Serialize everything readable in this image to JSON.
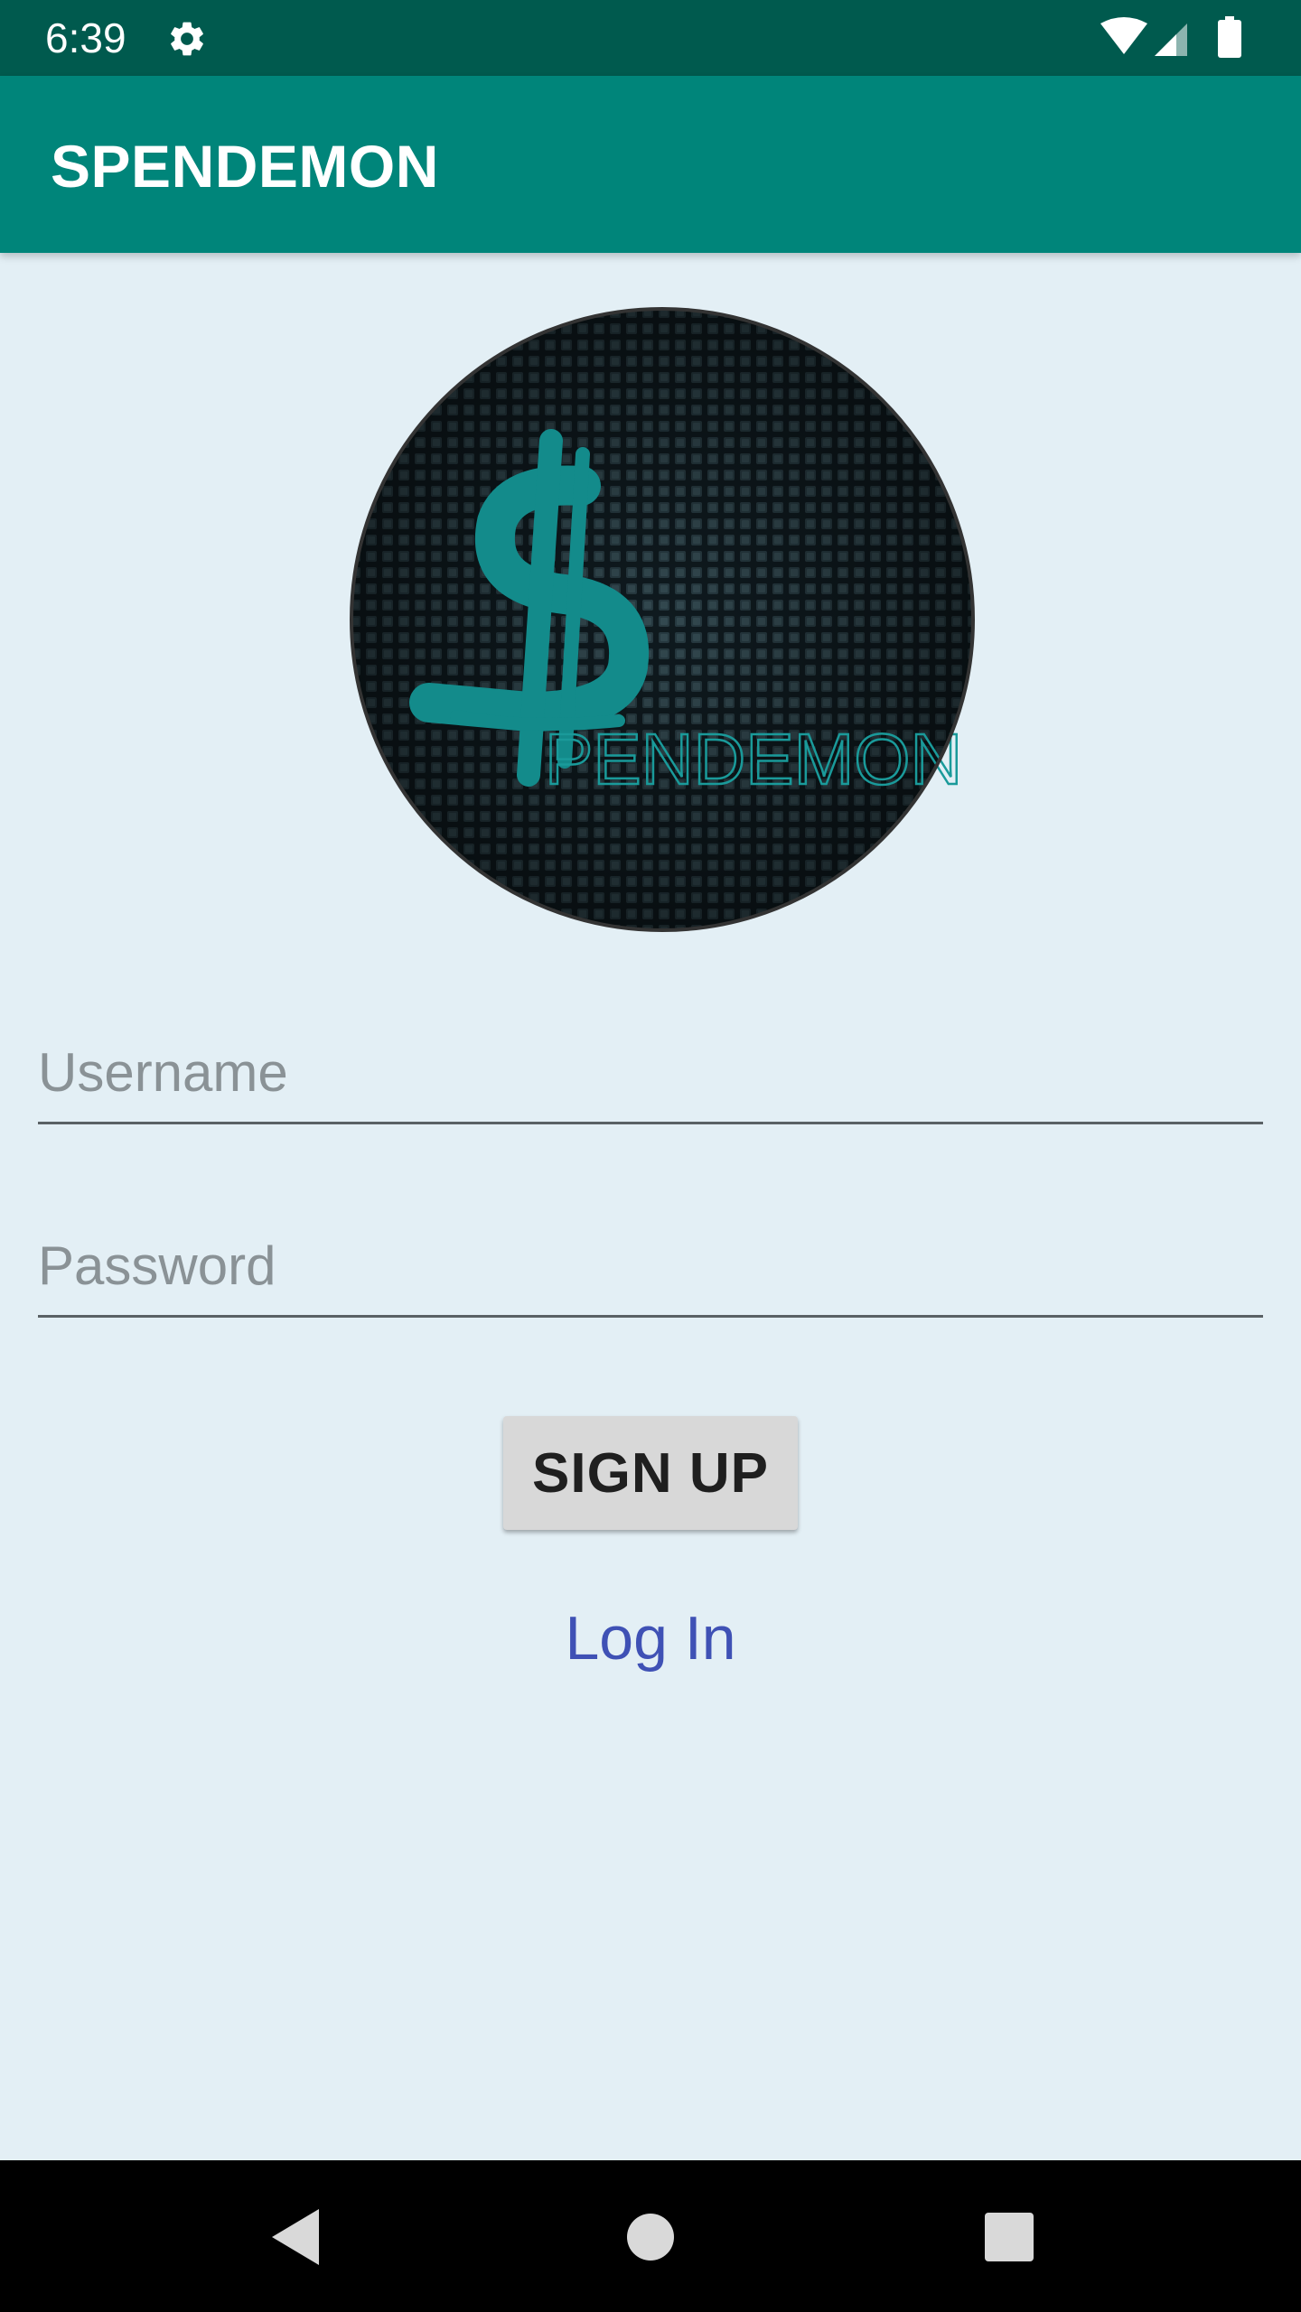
{
  "status_bar": {
    "time": "6:39",
    "icons": [
      "gear-icon",
      "wifi-icon",
      "signal-icon",
      "battery-icon"
    ]
  },
  "app_bar": {
    "title": "SPENDEMON"
  },
  "logo": {
    "text": "PENDEMON",
    "accent_color": "#138b8b"
  },
  "form": {
    "username_placeholder": "Username",
    "username_value": "",
    "password_placeholder": "Password",
    "password_value": "",
    "signup_label": "SIGN UP",
    "login_label": "Log In"
  },
  "nav_bar": {
    "icons": [
      "back-icon",
      "home-icon",
      "recents-icon"
    ]
  },
  "colors": {
    "status_bar": "#005a4e",
    "app_bar": "#00857a",
    "background": "#e3eff5",
    "link": "#3f51b5",
    "button": "#d8d8d8"
  }
}
